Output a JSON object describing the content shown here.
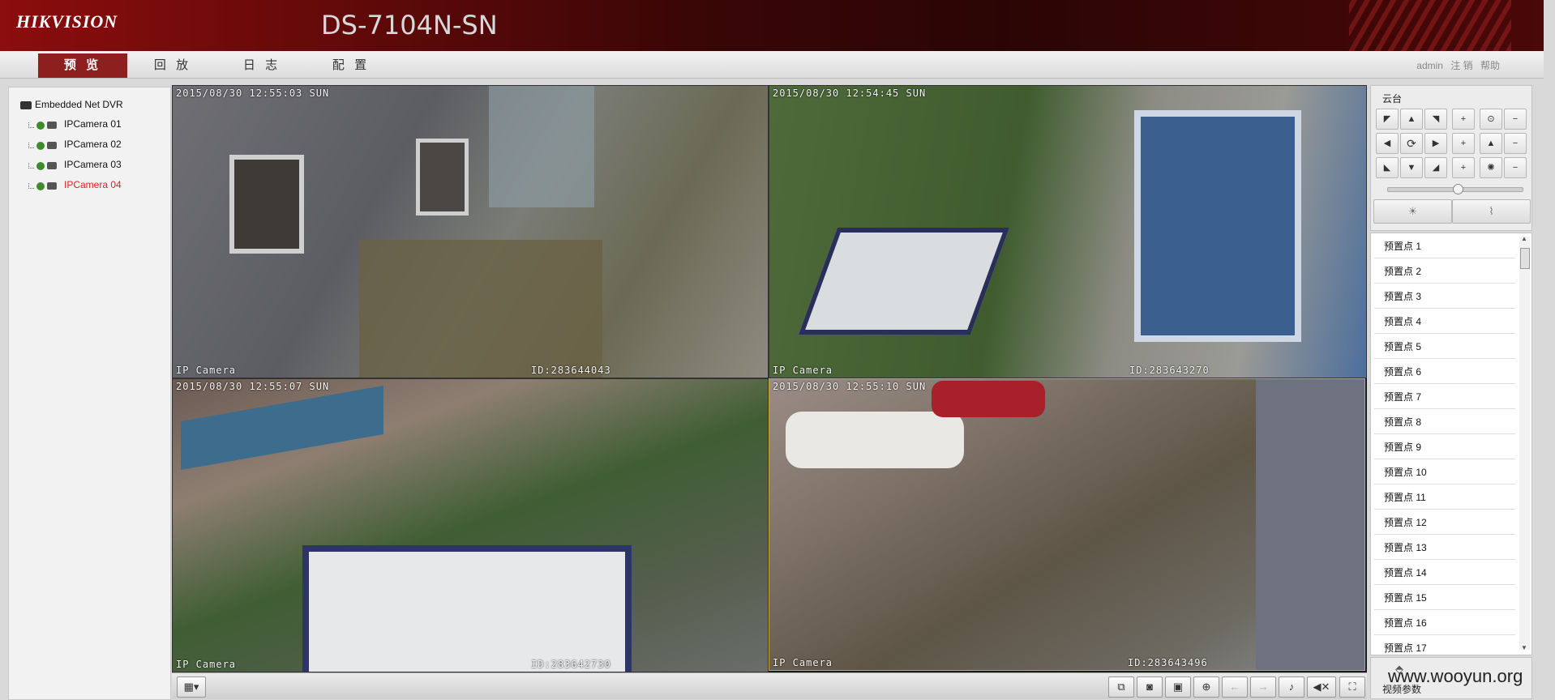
{
  "brand": {
    "logo": "HIKVISION",
    "model": "DS-7104N-SN"
  },
  "nav": {
    "tabs": [
      {
        "label": "预 览"
      },
      {
        "label": "回 放"
      },
      {
        "label": "日 志"
      },
      {
        "label": "配 置"
      }
    ],
    "active_tab": 0,
    "user": "admin",
    "logout": "注 销",
    "help": "帮助"
  },
  "tree": {
    "root": "Embedded Net DVR",
    "cameras": [
      "IPCamera 01",
      "IPCamera 02",
      "IPCamera 03",
      "IPCamera 04"
    ],
    "active_camera": 3
  },
  "video": {
    "tiles": [
      {
        "timestamp": "2015/08/30 12:55:03 SUN",
        "camera_label": "IP Camera",
        "id": "ID:283644043"
      },
      {
        "timestamp": "2015/08/30 12:54:45 SUN",
        "camera_label": "IP Camera",
        "id": "ID:283643270"
      },
      {
        "timestamp": "2015/08/30 12:55:07 SUN",
        "camera_label": "IP Camera",
        "id": "ID:283642730"
      },
      {
        "timestamp": "2015/08/30 12:55:10 SUN",
        "camera_label": "IP Camera",
        "id": "ID:283643496"
      }
    ],
    "selected_tile": 3
  },
  "ptz": {
    "title": "云台",
    "zoom_level": 0.52,
    "light_icon": "light-icon",
    "wiper_icon": "wiper-icon"
  },
  "presets": [
    "预置点  1",
    "预置点  2",
    "预置点  3",
    "预置点  4",
    "预置点  5",
    "预置点  6",
    "预置点  7",
    "预置点  8",
    "预置点  9",
    "预置点  10",
    "预置点  11",
    "预置点  12",
    "预置点  13",
    "预置点  14",
    "预置点  15",
    "预置点  16",
    "预置点  17"
  ],
  "video_params": {
    "label": "视频参数"
  },
  "watermark": "www.wooyun.org",
  "colors": {
    "accent": "#8e1f1f",
    "active_camera": "#e02020",
    "selected_tile_border": "#c8a840"
  }
}
